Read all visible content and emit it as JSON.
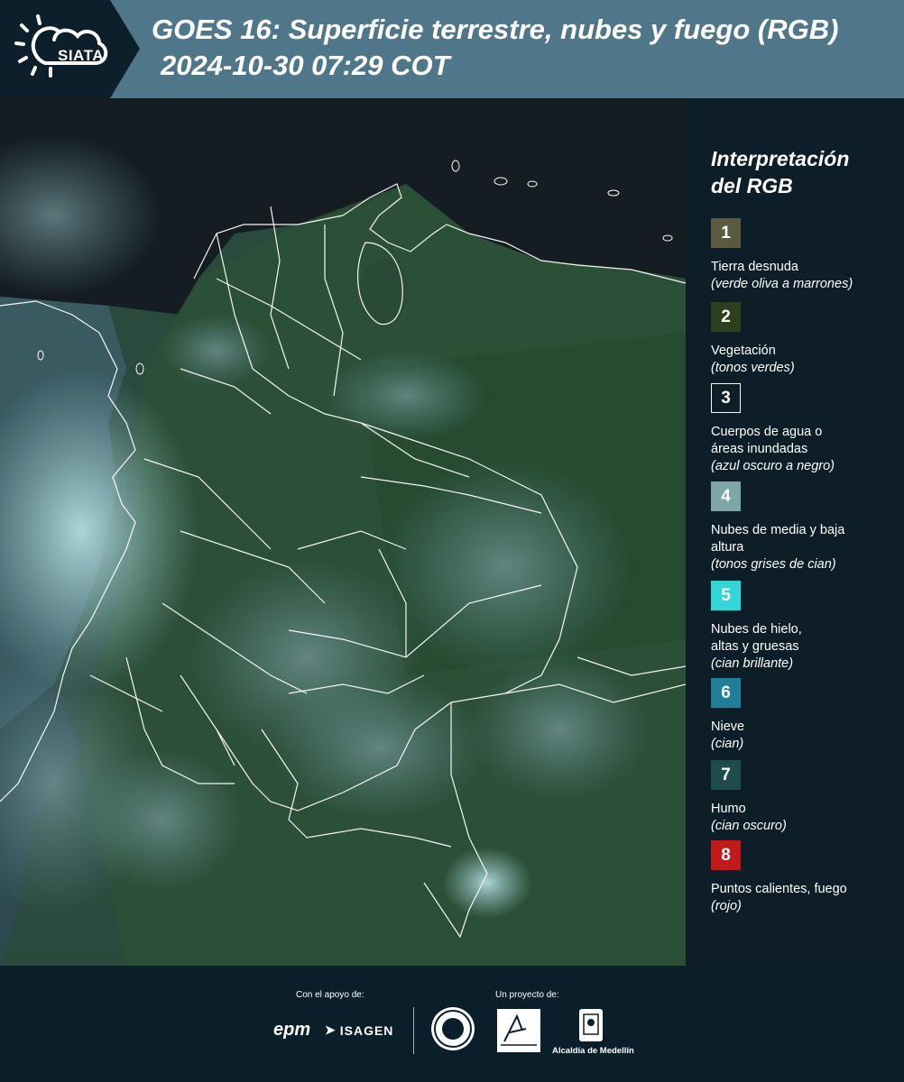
{
  "header": {
    "logo_text": "SIATA",
    "title": "GOES 16: Superficie terrestre, nubes y fuego (RGB)",
    "subtitle": "2024-10-30 07:29 COT"
  },
  "legend": {
    "title_line1": "Interpretación",
    "title_line2": "del RGB",
    "items": [
      {
        "number": "1",
        "color": "#5a5a40",
        "label": "Tierra desnuda",
        "sub": "(verde oliva a marrones)"
      },
      {
        "number": "2",
        "color": "#2e3f1e",
        "label": "Vegetación",
        "sub": "(tonos verdes)"
      },
      {
        "number": "3",
        "color": "#0d1e28",
        "label": "Cuerpos de agua o áreas inundadas",
        "sub": "(azul oscuro a negro)"
      },
      {
        "number": "4",
        "color": "#7fa6a6",
        "label": "Nubes de media y baja altura",
        "sub": "(tonos grises de cian)"
      },
      {
        "number": "5",
        "color": "#33d6d6",
        "label": "Nubes de hielo, altas y gruesas",
        "sub": "(cian brillante)"
      },
      {
        "number": "6",
        "color": "#1f7f96",
        "label": "Nieve",
        "sub": "(cian)"
      },
      {
        "number": "7",
        "color": "#1d4b4e",
        "label": "Humo",
        "sub": "(cian oscuro)"
      },
      {
        "number": "8",
        "color": "#c01a1a",
        "label": "Puntos calientes, fuego",
        "sub": "(rojo)"
      }
    ]
  },
  "footer": {
    "support_label": "Con el apoyo de:",
    "project_label": "Un proyecto de:",
    "epm": "epm",
    "isagen": "ISAGEN",
    "alcaldia": "Alcaldía de Medellín"
  }
}
